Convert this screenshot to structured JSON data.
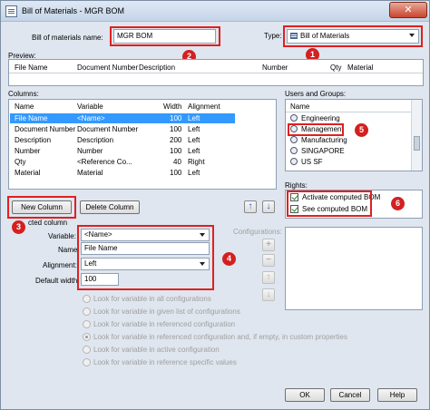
{
  "window": {
    "title": "Bill of Materials - MGR BOM",
    "close_glyph": "✕"
  },
  "bom_name": {
    "label": "Bill of materials name:",
    "value": "MGR BOM"
  },
  "type": {
    "label": "Type:",
    "value": "Bill of Materials",
    "icon": "table-icon"
  },
  "preview": {
    "label": "Preview:",
    "columns": [
      "File Name",
      "Document Number",
      "Description",
      "Number",
      "Qty",
      "Material"
    ]
  },
  "columns_section": {
    "label": "Columns:",
    "headers": [
      "Name",
      "Variable",
      "Width",
      "Alignment"
    ],
    "rows": [
      {
        "name": "File Name",
        "variable": "<Name>",
        "width": "100",
        "alignment": "Left",
        "selected": true
      },
      {
        "name": "Document Number",
        "variable": "Document Number",
        "width": "100",
        "alignment": "Left"
      },
      {
        "name": "Description",
        "variable": "Description",
        "width": "200",
        "alignment": "Left"
      },
      {
        "name": "Number",
        "variable": "Number",
        "width": "100",
        "alignment": "Left"
      },
      {
        "name": "Qty",
        "variable": "<Reference Co...",
        "width": "40",
        "alignment": "Right"
      },
      {
        "name": "Material",
        "variable": "Material",
        "width": "100",
        "alignment": "Left"
      }
    ],
    "new_column": "New Column",
    "delete_column": "Delete Column"
  },
  "users": {
    "label": "Users and Groups:",
    "header": "Name",
    "items": [
      "Engineering",
      "Management",
      "Manufacturing",
      "SINGAPORE",
      "US SF"
    ]
  },
  "rights": {
    "label": "Rights:",
    "items": [
      {
        "label": "Activate computed BOM",
        "checked": true
      },
      {
        "label": "See computed BOM",
        "checked": true
      }
    ]
  },
  "selected_column": {
    "label": "cted column",
    "variable_label": "Variable:",
    "variable_value": "<Name>",
    "name_label": "Name:",
    "name_value": "File Name",
    "alignment_label": "Alignment:",
    "alignment_value": "Left",
    "width_label": "Default width:",
    "width_value": "100"
  },
  "configurations": {
    "label": "Configurations:"
  },
  "options": [
    {
      "label": "Look for variable in all configurations",
      "selected": false
    },
    {
      "label": "Look for variable in given list of configurations",
      "selected": false
    },
    {
      "label": "Look for variable in referenced configuration",
      "selected": false
    },
    {
      "label": "Look for variable in referenced configuration and, if empty, in custom properties",
      "selected": true
    },
    {
      "label": "Look for variable in active configuration",
      "selected": false
    },
    {
      "label": "Look for variable in reference specific values",
      "selected": false
    }
  ],
  "footer": {
    "ok": "OK",
    "cancel": "Cancel",
    "help": "Help"
  },
  "annotations": [
    "1",
    "2",
    "3",
    "4",
    "5",
    "6"
  ],
  "colors": {
    "selection": "#3399ff",
    "annotation_red": "#e02020",
    "dialog_bg": "#dfe6ef"
  }
}
